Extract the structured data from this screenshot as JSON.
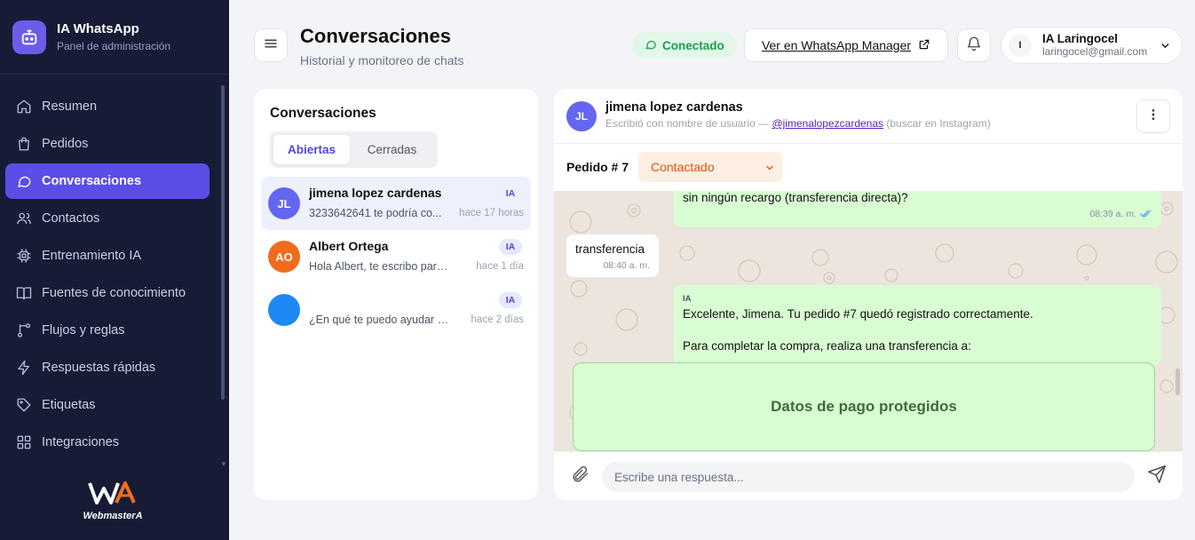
{
  "brand": {
    "title": "IA WhatsApp",
    "subtitle": "Panel de administración",
    "logo_icon": "robot-icon"
  },
  "nav": {
    "items": [
      {
        "label": "Resumen",
        "icon": "home-icon",
        "active": false
      },
      {
        "label": "Pedidos",
        "icon": "bag-icon",
        "active": false
      },
      {
        "label": "Conversaciones",
        "icon": "chat-icon",
        "active": true
      },
      {
        "label": "Contactos",
        "icon": "users-icon",
        "active": false
      },
      {
        "label": "Entrenamiento IA",
        "icon": "chip-icon",
        "active": false
      },
      {
        "label": "Fuentes de conocimiento",
        "icon": "book-icon",
        "active": false
      },
      {
        "label": "Flujos y reglas",
        "icon": "flow-icon",
        "active": false
      },
      {
        "label": "Respuestas rápidas",
        "icon": "bolt-icon",
        "active": false
      },
      {
        "label": "Etiquetas",
        "icon": "tag-icon",
        "active": false
      },
      {
        "label": "Integraciones",
        "icon": "grid-icon",
        "active": false
      }
    ]
  },
  "watermark": {
    "text": "WebmasterA"
  },
  "header": {
    "title": "Conversaciones",
    "subtitle": "Historial y monitoreo de chats",
    "status": "Conectado",
    "wa_link": "Ver en WhatsApp Manager",
    "user": {
      "initial": "I",
      "name": "IA Laringocel",
      "email": "laringocel@gmail.com"
    }
  },
  "list": {
    "title": "Conversaciones",
    "tabs": {
      "open": "Abiertas",
      "closed": "Cerradas"
    },
    "items": [
      {
        "initials": "JL",
        "name": "jimena lopez cardenas",
        "preview": "3233642641 te podría co...",
        "time": "hace 17 horas",
        "badge": "IA",
        "color": "#6366f1"
      },
      {
        "initials": "AO",
        "name": "Albert Ortega",
        "preview": "Hola Albert, te escribo para ...",
        "time": "hace 1 día",
        "badge": "IA",
        "color": "#f26b1d"
      },
      {
        "initials": "",
        "name": "",
        "preview": "¿En qué te puedo ayudar h...",
        "time": "hace 2 días",
        "badge": "IA",
        "color": "#1e88f5"
      }
    ]
  },
  "chat": {
    "initials": "JL",
    "name": "jimena lopez cardenas",
    "meta_prefix": "Escribió con nombre de usuario —",
    "handle": "@jimenalopezcardenas",
    "meta_suffix": "(buscar en Instagram)",
    "order_label": "Pedido #",
    "order_number": "7",
    "order_status": "Contactado",
    "messages": [
      {
        "text": "sin ningún recargo (transferencia directa)?",
        "time": "08:39 a. m."
      },
      {
        "text": "transferencia",
        "time": "08:40 a. m."
      },
      {
        "sender": "IA",
        "line1": "Excelente, Jimena. Tu pedido #7 quedó registrado correctamente.",
        "line2": "Para completar la compra, realiza una transferencia a:"
      }
    ],
    "payment_card": "Datos de pago protegidos",
    "reply_placeholder": "Escribe una respuesta..."
  }
}
